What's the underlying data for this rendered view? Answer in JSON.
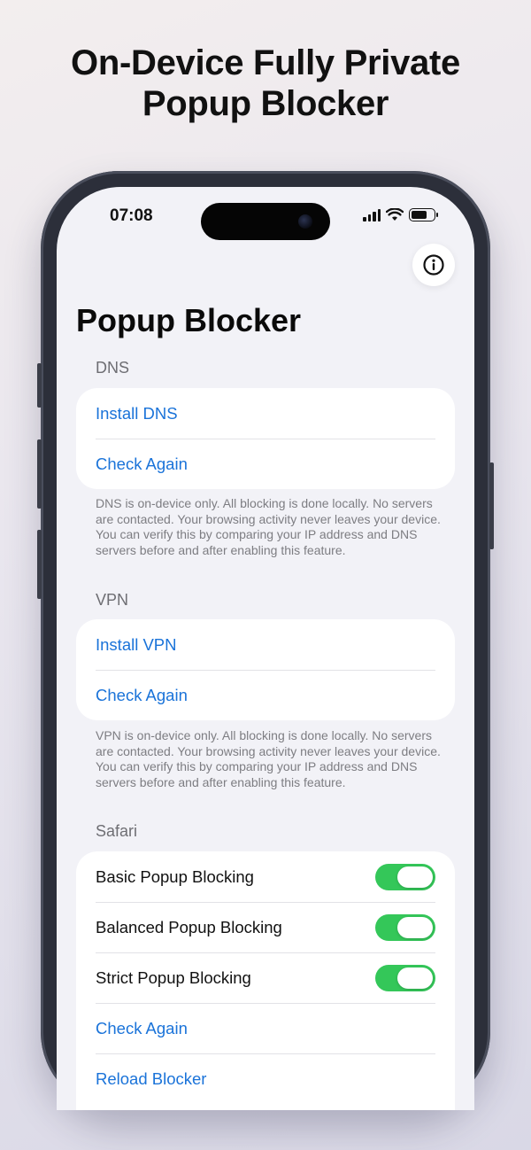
{
  "headline": {
    "line1": "On-Device Fully Private",
    "line2": "Popup Blocker"
  },
  "status_bar": {
    "time": "07:08"
  },
  "page": {
    "title": "Popup Blocker"
  },
  "dns": {
    "header": "DNS",
    "install_label": "Install DNS",
    "check_label": "Check Again",
    "footnote": "DNS is on-device only. All blocking is done locally. No servers are contacted. Your browsing activity never leaves your device. You can verify this by comparing your IP address and DNS servers before and after enabling this feature."
  },
  "vpn": {
    "header": "VPN",
    "install_label": "Install VPN",
    "check_label": "Check Again",
    "footnote": "VPN is on-device only. All blocking is done locally. No servers are contacted. Your browsing activity never leaves your device. You can verify this by comparing your IP address and DNS servers before and after enabling this feature."
  },
  "safari": {
    "header": "Safari",
    "toggles": [
      {
        "label": "Basic Popup Blocking",
        "on": true
      },
      {
        "label": "Balanced Popup Blocking",
        "on": true
      },
      {
        "label": "Strict Popup Blocking",
        "on": true
      }
    ],
    "check_label": "Check Again",
    "reload_label": "Reload Blocker"
  },
  "colors": {
    "accent": "#1a73d9",
    "toggle_on": "#34c759",
    "background": "#f2f2f7"
  }
}
